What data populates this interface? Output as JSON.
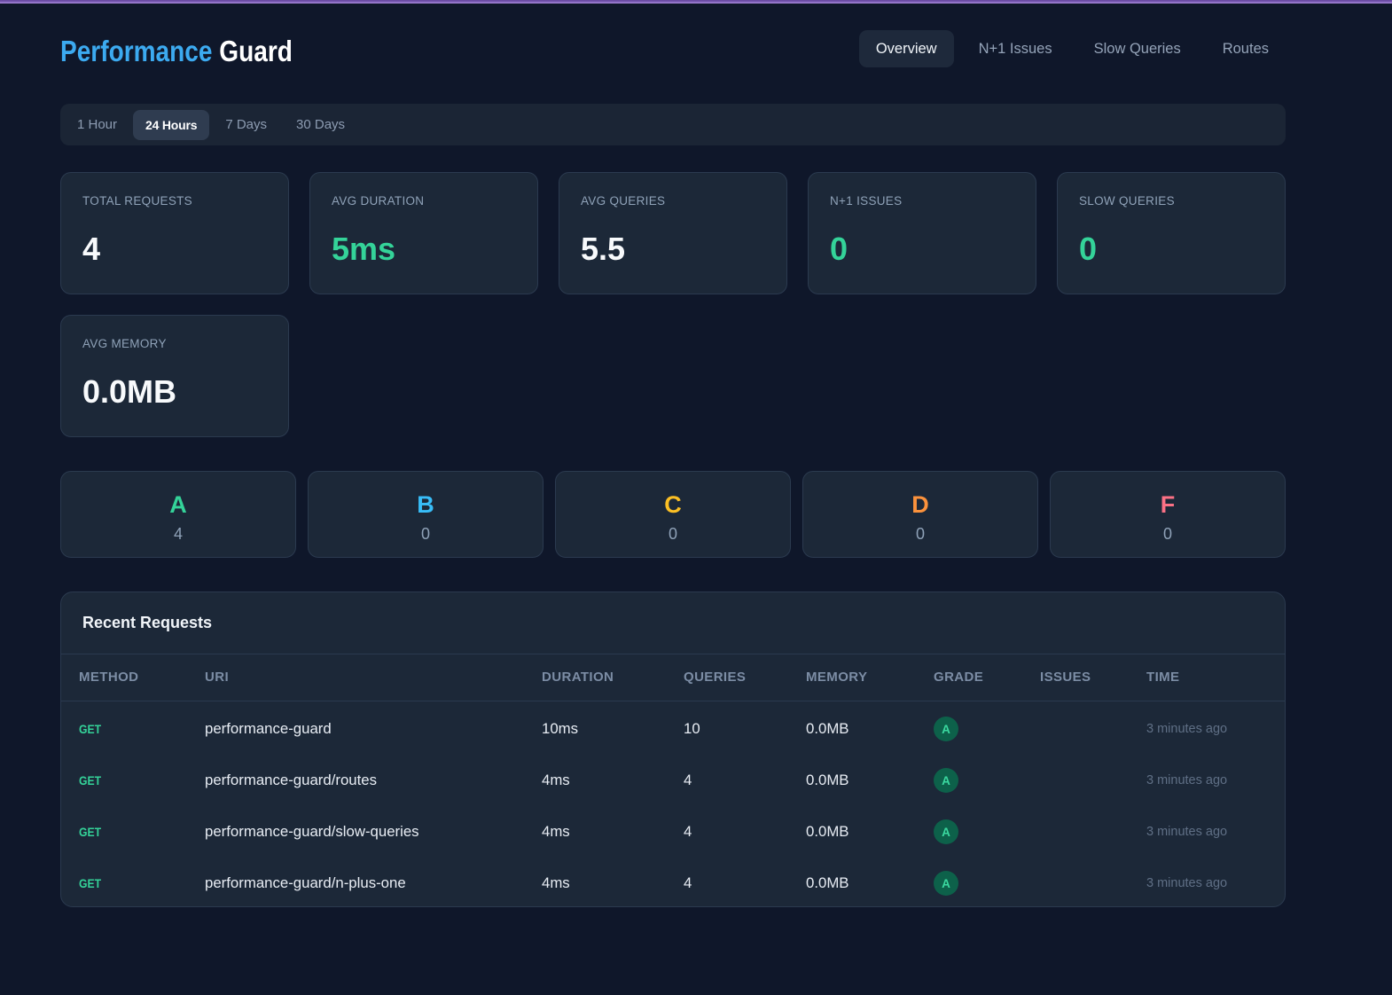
{
  "accent_bar_colors": [
    "#66489e",
    "#9e7fd3"
  ],
  "header": {
    "title_primary": "Performance",
    "title_secondary": "Guard",
    "nav": [
      {
        "label": "Overview",
        "active": true
      },
      {
        "label": "N+1 Issues",
        "active": false
      },
      {
        "label": "Slow Queries",
        "active": false
      },
      {
        "label": "Routes",
        "active": false
      }
    ]
  },
  "time_range": {
    "options": [
      {
        "label": "1 Hour",
        "active": false
      },
      {
        "label": "24 Hours",
        "active": true
      },
      {
        "label": "7 Days",
        "active": false
      },
      {
        "label": "30 Days",
        "active": false
      }
    ]
  },
  "stats": [
    {
      "label": "TOTAL REQUESTS",
      "value": "4",
      "value_color": "#f8fafc"
    },
    {
      "label": "AVG DURATION",
      "value": "5ms",
      "value_color": "#34d399"
    },
    {
      "label": "AVG QUERIES",
      "value": "5.5",
      "value_color": "#f8fafc"
    },
    {
      "label": "N+1 ISSUES",
      "value": "0",
      "value_color": "#34d399"
    },
    {
      "label": "SLOW QUERIES",
      "value": "0",
      "value_color": "#34d399"
    },
    {
      "label": "AVG MEMORY",
      "value": "0.0MB",
      "value_color": "#f8fafc"
    }
  ],
  "grades": [
    {
      "letter": "A",
      "count": "4",
      "color": "#34d399"
    },
    {
      "letter": "B",
      "count": "0",
      "color": "#38bdf8"
    },
    {
      "letter": "C",
      "count": "0",
      "color": "#fbbf24"
    },
    {
      "letter": "D",
      "count": "0",
      "color": "#fb923c"
    },
    {
      "letter": "F",
      "count": "0",
      "color": "#fb7185"
    }
  ],
  "recent_requests": {
    "title": "Recent Requests",
    "columns": [
      "METHOD",
      "URI",
      "DURATION",
      "QUERIES",
      "MEMORY",
      "GRADE",
      "ISSUES",
      "TIME"
    ],
    "rows": [
      {
        "method": "GET",
        "uri": "performance-guard",
        "duration": "10ms",
        "queries": "10",
        "memory": "0.0MB",
        "grade": "A",
        "issues": "",
        "time": "3 minutes ago"
      },
      {
        "method": "GET",
        "uri": "performance-guard/routes",
        "duration": "4ms",
        "queries": "4",
        "memory": "0.0MB",
        "grade": "A",
        "issues": "",
        "time": "3 minutes ago"
      },
      {
        "method": "GET",
        "uri": "performance-guard/slow-queries",
        "duration": "4ms",
        "queries": "4",
        "memory": "0.0MB",
        "grade": "A",
        "issues": "",
        "time": "3 minutes ago"
      },
      {
        "method": "GET",
        "uri": "performance-guard/n-plus-one",
        "duration": "4ms",
        "queries": "4",
        "memory": "0.0MB",
        "grade": "A",
        "issues": "",
        "time": "3 minutes ago"
      }
    ]
  }
}
